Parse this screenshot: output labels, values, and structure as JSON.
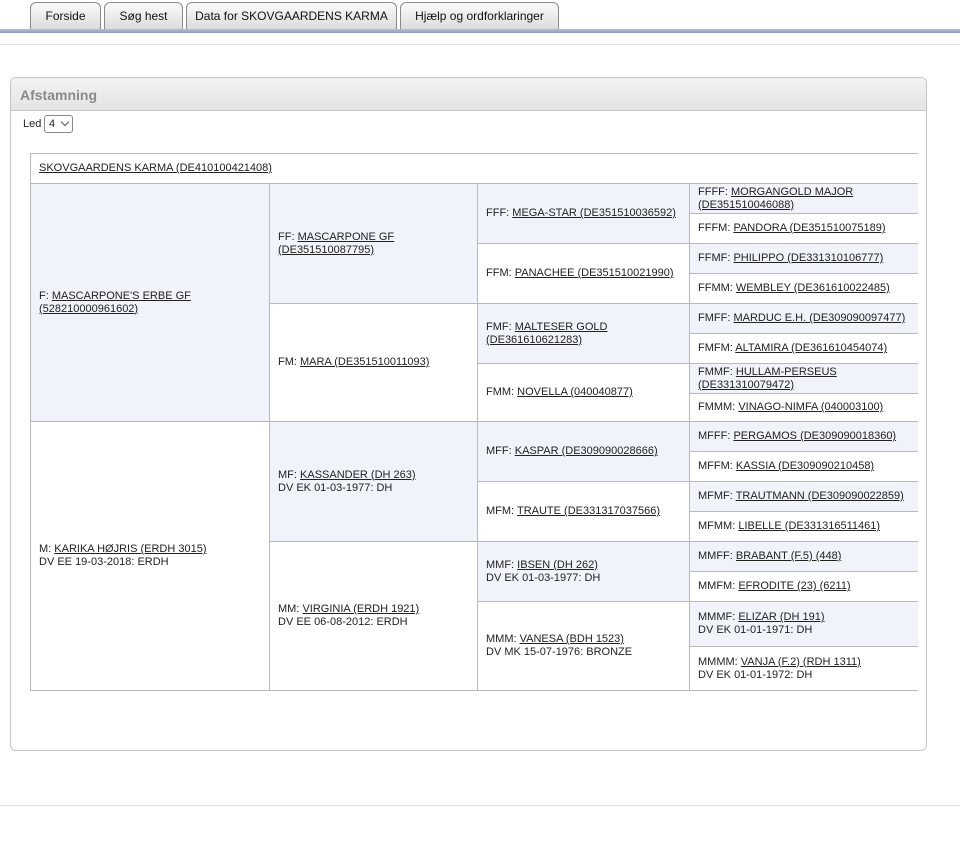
{
  "tabs": [
    {
      "label": "Forside"
    },
    {
      "label": "Søg hest"
    },
    {
      "label": "Data for SKOVGAARDENS KARMA"
    },
    {
      "label": "Hjælp og ordforklaringer"
    }
  ],
  "panel": {
    "title": "Afstamning",
    "led_label": "Led",
    "led_value": "4"
  },
  "subject": "SKOVGAARDENS KARMA (DE410100421408)",
  "gen1": [
    {
      "prefix": "F:",
      "name": "MASCARPONE'S ERBE GF (528210000961602)",
      "extra": ""
    },
    {
      "prefix": "M:",
      "name": "KARIKA HØJRIS (ERDH 3015)",
      "extra": "DV EE 19-03-2018: ERDH"
    }
  ],
  "gen2": [
    {
      "prefix": "FF:",
      "name": "MASCARPONE GF (DE351510087795)",
      "extra": ""
    },
    {
      "prefix": "FM:",
      "name": "MARA (DE351510011093)",
      "extra": ""
    },
    {
      "prefix": "MF:",
      "name": "KASSANDER (DH 263)",
      "extra": "DV EK 01-03-1977: DH"
    },
    {
      "prefix": "MM:",
      "name": "VIRGINIA (ERDH 1921)",
      "extra": "DV EE 06-08-2012: ERDH"
    }
  ],
  "gen3": [
    {
      "prefix": "FFF:",
      "name": "MEGA-STAR (DE351510036592)",
      "extra": ""
    },
    {
      "prefix": "FFM:",
      "name": "PANACHEE (DE351510021990)",
      "extra": ""
    },
    {
      "prefix": "FMF:",
      "name": "MALTESER GOLD (DE361610621283)",
      "extra": ""
    },
    {
      "prefix": "FMM:",
      "name": "NOVELLA (040040877)",
      "extra": ""
    },
    {
      "prefix": "MFF:",
      "name": "KASPAR (DE309090028666)",
      "extra": ""
    },
    {
      "prefix": "MFM:",
      "name": "TRAUTE (DE331317037566)",
      "extra": ""
    },
    {
      "prefix": "MMF:",
      "name": "IBSEN (DH 262)",
      "extra": "DV EK 01-03-1977: DH"
    },
    {
      "prefix": "MMM:",
      "name": "VANESA (BDH 1523)",
      "extra": "DV MK 15-07-1976: BRONZE"
    }
  ],
  "gen4": [
    {
      "prefix": "FFFF:",
      "name": "MORGANGOLD MAJOR (DE351510046088)",
      "extra": ""
    },
    {
      "prefix": "FFFM:",
      "name": "PANDORA (DE351510075189)",
      "extra": ""
    },
    {
      "prefix": "FFMF:",
      "name": "PHILIPPO (DE331310106777)",
      "extra": ""
    },
    {
      "prefix": "FFMM:",
      "name": "WEMBLEY (DE361610022485)",
      "extra": ""
    },
    {
      "prefix": "FMFF:",
      "name": "MARDUC E.H. (DE309090097477)",
      "extra": ""
    },
    {
      "prefix": "FMFM:",
      "name": "ALTAMIRA (DE361610454074)",
      "extra": ""
    },
    {
      "prefix": "FMMF:",
      "name": "HULLAM-PERSEUS (DE331310079472)",
      "extra": ""
    },
    {
      "prefix": "FMMM:",
      "name": "VINAGO-NIMFA (040003100)",
      "extra": ""
    },
    {
      "prefix": "MFFF:",
      "name": "PERGAMOS (DE309090018360)",
      "extra": ""
    },
    {
      "prefix": "MFFM:",
      "name": "KASSIA (DE309090210458)",
      "extra": ""
    },
    {
      "prefix": "MFMF:",
      "name": "TRAUTMANN (DE309090022859)",
      "extra": ""
    },
    {
      "prefix": "MFMM:",
      "name": "LIBELLE (DE331316511461)",
      "extra": ""
    },
    {
      "prefix": "MMFF:",
      "name": "BRABANT (F.5) (448)",
      "extra": ""
    },
    {
      "prefix": "MMFM:",
      "name": "EFRODITE (23) (6211)",
      "extra": ""
    },
    {
      "prefix": "MMMF:",
      "name": "ELIZAR (DH 191)",
      "extra": "DV EK 01-01-1971: DH"
    },
    {
      "prefix": "MMMM:",
      "name": "VANJA (F.2) (RDH 1311)",
      "extra": "DV EK 01-01-1972: DH"
    }
  ]
}
